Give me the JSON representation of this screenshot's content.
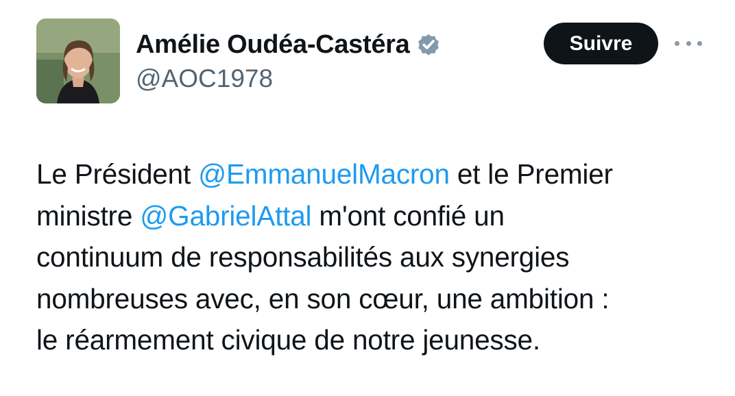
{
  "author": {
    "display_name": "Amélie Oudéa-Castéra",
    "handle": "@AOC1978",
    "verified": true
  },
  "actions": {
    "follow_label": "Suivre",
    "more_icon": "more-horizontal-icon"
  },
  "tweet": {
    "line1_pre": "Le Président ",
    "mention1": "@EmmanuelMacron",
    "line1_post": " et le Premier",
    "line2_pre": "ministre ",
    "mention2": "@GabrielAttal",
    "line2_post": " m'ont confié un",
    "line3": "continuum de responsabilités aux synergies",
    "line4": "nombreuses avec, en son cœur, une ambition :",
    "line5": "le réarmement civique de notre jeunesse."
  },
  "colors": {
    "mention": "#1d9bf0",
    "secondary_text": "#536471",
    "button_bg": "#0f1419"
  }
}
